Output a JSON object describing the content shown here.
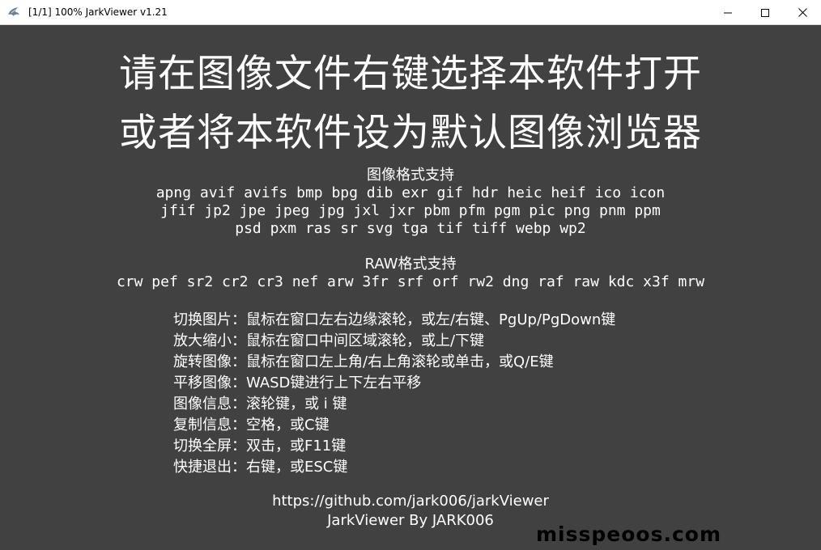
{
  "window": {
    "title": "[1/1] 100% JarkViewer v1.21",
    "icon": "jarkviewer-app-icon",
    "controls": {
      "minimize_icon": "minimize-icon",
      "maximize_icon": "maximize-icon",
      "close_icon": "close-icon"
    }
  },
  "colors": {
    "background": "#414141",
    "text": "#ffffff",
    "titlebar": "#ffffff",
    "watermark": "#000000"
  },
  "headline": [
    "请在图像文件右键选择本软件打开",
    "或者将本软件设为默认图像浏览器"
  ],
  "image_formats": {
    "heading": "图像格式支持",
    "lines": [
      "apng avif avifs bmp bpg dib exr gif hdr heic heif ico icon",
      "jfif jp2 jpe jpeg jpg jxl jxr pbm pfm pgm pic png pnm ppm",
      "psd pxm ras sr svg tga tif tiff webp wp2"
    ]
  },
  "raw_formats": {
    "heading": "RAW格式支持",
    "lines": [
      "crw pef sr2 cr2 cr3 nef arw 3fr srf orf rw2 dng raf raw kdc x3f mrw"
    ]
  },
  "shortcuts": [
    "切换图片：鼠标在窗口左右边缘滚轮，或左/右键、PgUp/PgDown键",
    "放大缩小：鼠标在窗口中间区域滚轮，或上/下键",
    "旋转图像：鼠标在窗口左上角/右上角滚轮或单击，或Q/E键",
    "平移图像：WASD键进行上下左右平移",
    "图像信息：滚轮键，或 i 键",
    "复制信息：空格，或C键",
    "切换全屏：双击，或F11键",
    "快捷退出：右键，或ESC键"
  ],
  "footer": {
    "url": "https://github.com/jark006/jarkViewer",
    "author": "JarkViewer By JARK006"
  },
  "watermark": "misspeoos.com"
}
